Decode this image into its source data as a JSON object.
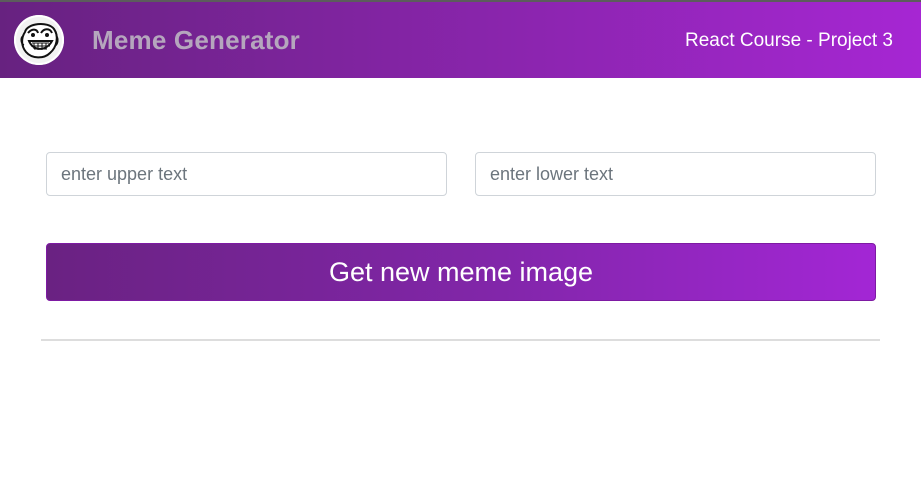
{
  "header": {
    "logo_icon": "troll-face-icon",
    "title": "Meme Generator",
    "subtitle": "React Course - Project 3",
    "gradient_start": "#672280",
    "gradient_end": "#a626d3"
  },
  "form": {
    "upper_placeholder": "enter upper text",
    "lower_placeholder": "enter lower text",
    "upper_value": "",
    "lower_value": "",
    "button_label": "Get new meme image"
  }
}
